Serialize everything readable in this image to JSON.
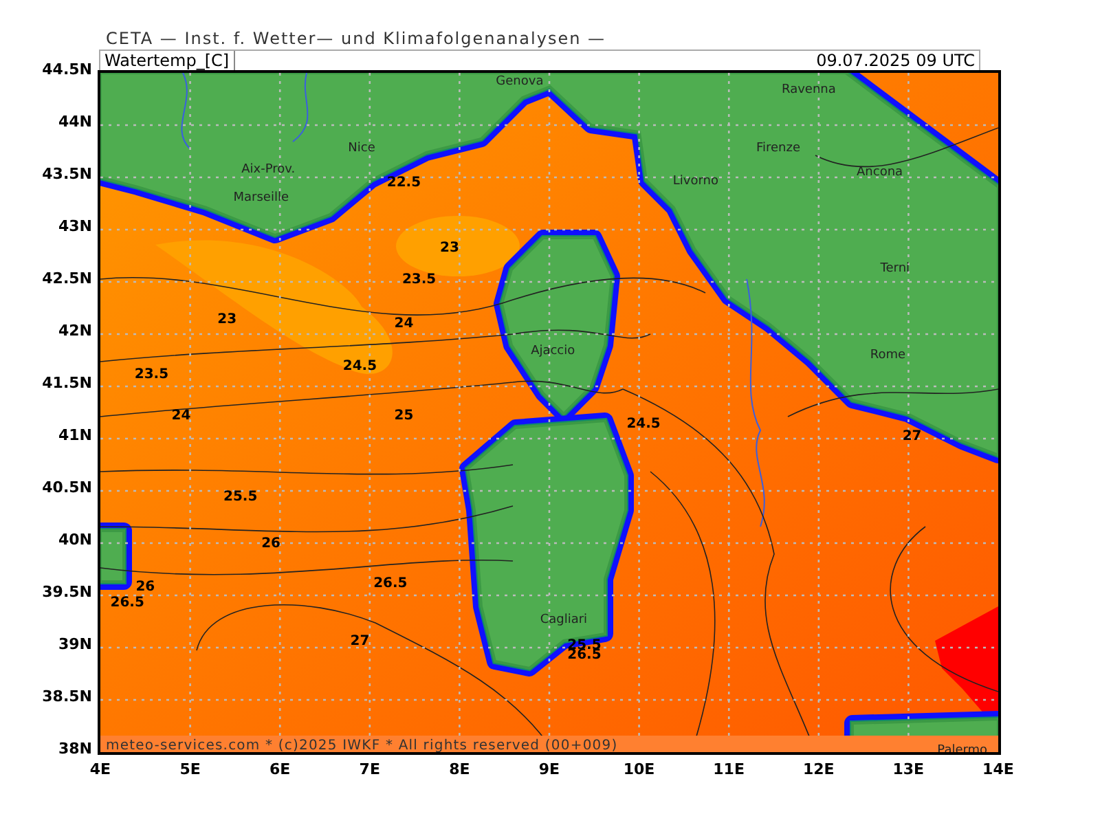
{
  "header": {
    "title": "CETA — Inst. f. Wetter— und Klimafolgenanalysen —"
  },
  "title_bar": {
    "field": "Watertemp_[C]",
    "valid_time": "09.07.2025 09 UTC"
  },
  "map": {
    "y_ticks": [
      "44.5N",
      "44N",
      "43.5N",
      "43N",
      "42.5N",
      "42N",
      "41.5N",
      "41N",
      "40.5N",
      "40N",
      "39.5N",
      "39N",
      "38.5N",
      "38N"
    ],
    "x_ticks": [
      "4E",
      "5E",
      "6E",
      "7E",
      "8E",
      "9E",
      "10E",
      "11E",
      "12E",
      "13E",
      "14E"
    ],
    "cities": [
      "Genova",
      "Ravenna",
      "Nice",
      "Firenze",
      "Aix-Prov.",
      "Ancona",
      "Livorno",
      "Marseille",
      "Terni",
      "Ajaccio",
      "Rome",
      "Cagliari",
      "Palermo"
    ],
    "contour_labels": [
      "22.5",
      "23",
      "23.5",
      "23",
      "24",
      "23.5",
      "24.5",
      "24",
      "25",
      "24.5",
      "27",
      "25.5",
      "26",
      "26",
      "26.5",
      "26.5",
      "27",
      "25.5",
      "26.5"
    ],
    "footer": "meteo-services.com * (c)2025 IWKF * All rights reserved (00+009)"
  }
}
